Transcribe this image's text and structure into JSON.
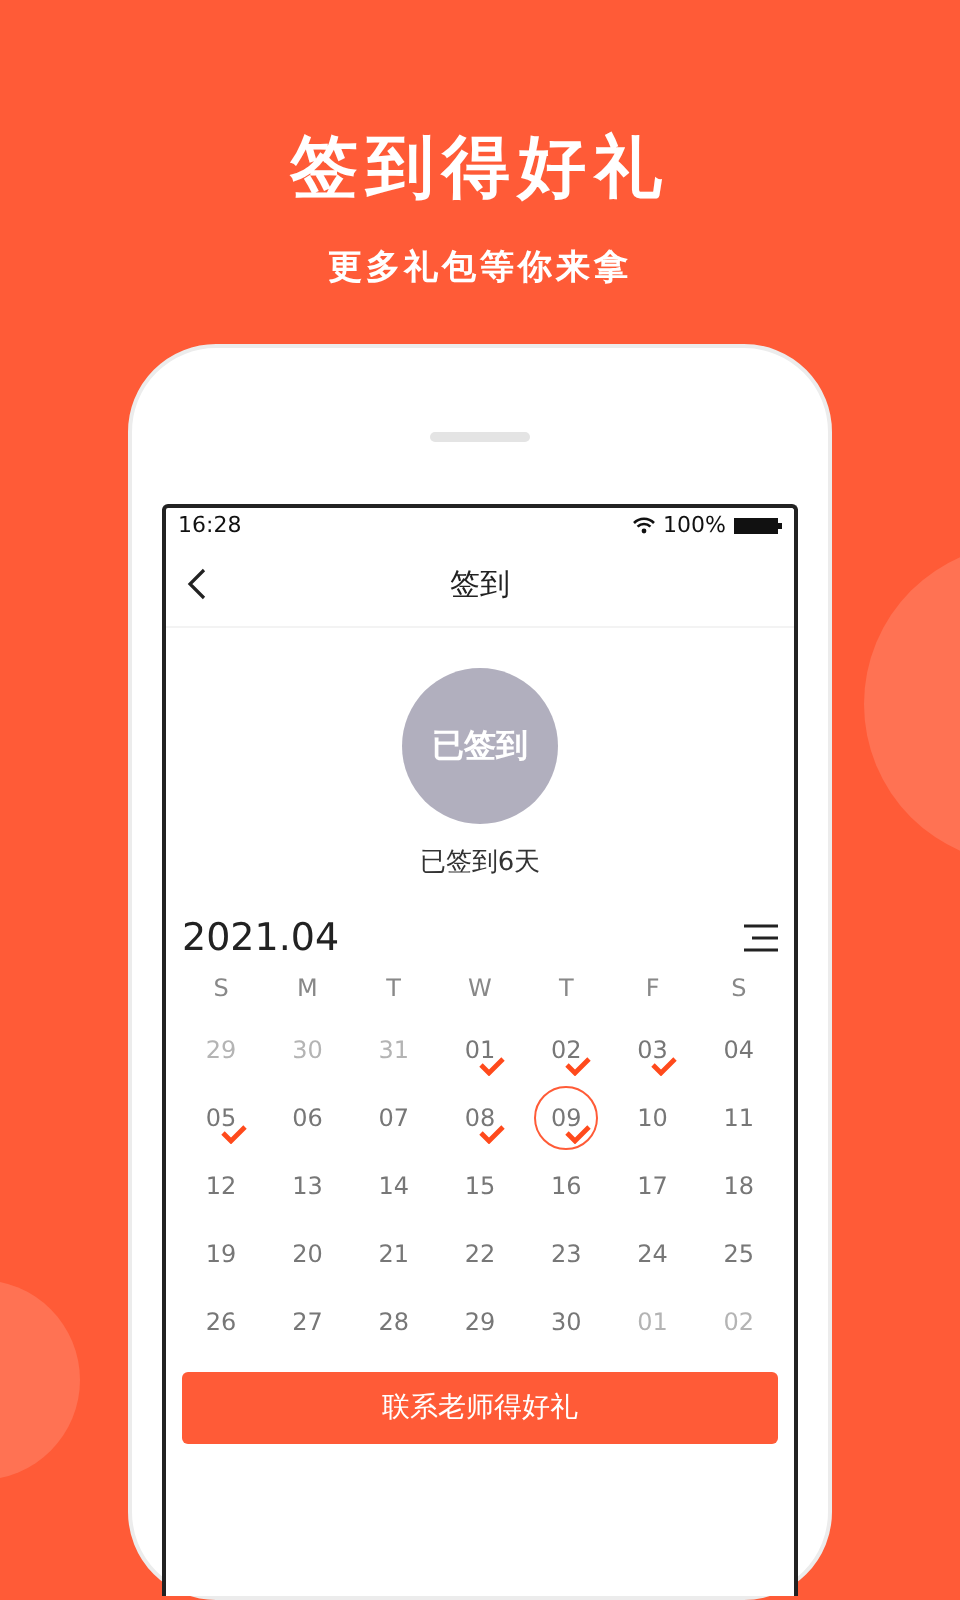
{
  "headline": "签到得好礼",
  "subtitle": "更多礼包等你来拿",
  "status_bar": {
    "time": "16:28",
    "battery": "100%"
  },
  "nav": {
    "title": "签到"
  },
  "sign_badge": "已签到",
  "sign_summary": "已签到6天",
  "calendar": {
    "month": "2021.04",
    "weekdays": [
      "S",
      "M",
      "T",
      "W",
      "T",
      "F",
      "S"
    ],
    "days": [
      {
        "label": "29",
        "outside": true,
        "checked": false,
        "today": false
      },
      {
        "label": "30",
        "outside": true,
        "checked": false,
        "today": false
      },
      {
        "label": "31",
        "outside": true,
        "checked": false,
        "today": false
      },
      {
        "label": "01",
        "outside": false,
        "checked": true,
        "today": false
      },
      {
        "label": "02",
        "outside": false,
        "checked": true,
        "today": false
      },
      {
        "label": "03",
        "outside": false,
        "checked": true,
        "today": false
      },
      {
        "label": "04",
        "outside": false,
        "checked": false,
        "today": false
      },
      {
        "label": "05",
        "outside": false,
        "checked": true,
        "today": false
      },
      {
        "label": "06",
        "outside": false,
        "checked": false,
        "today": false
      },
      {
        "label": "07",
        "outside": false,
        "checked": false,
        "today": false
      },
      {
        "label": "08",
        "outside": false,
        "checked": true,
        "today": false
      },
      {
        "label": "09",
        "outside": false,
        "checked": true,
        "today": true
      },
      {
        "label": "10",
        "outside": false,
        "checked": false,
        "today": false
      },
      {
        "label": "11",
        "outside": false,
        "checked": false,
        "today": false
      },
      {
        "label": "12",
        "outside": false,
        "checked": false,
        "today": false
      },
      {
        "label": "13",
        "outside": false,
        "checked": false,
        "today": false
      },
      {
        "label": "14",
        "outside": false,
        "checked": false,
        "today": false
      },
      {
        "label": "15",
        "outside": false,
        "checked": false,
        "today": false
      },
      {
        "label": "16",
        "outside": false,
        "checked": false,
        "today": false
      },
      {
        "label": "17",
        "outside": false,
        "checked": false,
        "today": false
      },
      {
        "label": "18",
        "outside": false,
        "checked": false,
        "today": false
      },
      {
        "label": "19",
        "outside": false,
        "checked": false,
        "today": false
      },
      {
        "label": "20",
        "outside": false,
        "checked": false,
        "today": false
      },
      {
        "label": "21",
        "outside": false,
        "checked": false,
        "today": false
      },
      {
        "label": "22",
        "outside": false,
        "checked": false,
        "today": false
      },
      {
        "label": "23",
        "outside": false,
        "checked": false,
        "today": false
      },
      {
        "label": "24",
        "outside": false,
        "checked": false,
        "today": false
      },
      {
        "label": "25",
        "outside": false,
        "checked": false,
        "today": false
      },
      {
        "label": "26",
        "outside": false,
        "checked": false,
        "today": false
      },
      {
        "label": "27",
        "outside": false,
        "checked": false,
        "today": false
      },
      {
        "label": "28",
        "outside": false,
        "checked": false,
        "today": false
      },
      {
        "label": "29",
        "outside": false,
        "checked": false,
        "today": false
      },
      {
        "label": "30",
        "outside": false,
        "checked": false,
        "today": false
      },
      {
        "label": "01",
        "outside": true,
        "checked": false,
        "today": false
      },
      {
        "label": "02",
        "outside": true,
        "checked": false,
        "today": false
      }
    ]
  },
  "cta_button": "联系老师得好礼"
}
